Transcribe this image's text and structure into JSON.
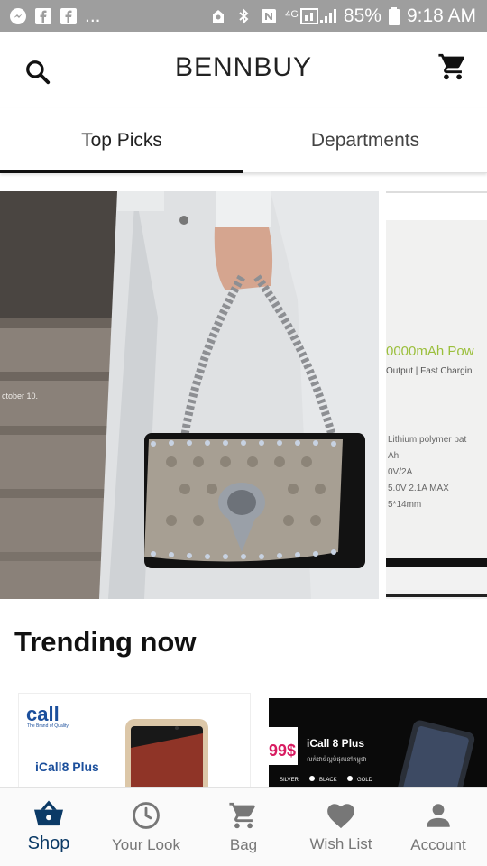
{
  "status_bar": {
    "left_icons": [
      "messenger-icon",
      "facebook-icon",
      "facebook-icon",
      "more-dots"
    ],
    "dots": "...",
    "right_icons": [
      "alarm-icon",
      "bluetooth-icon",
      "nfc-icon",
      "4g-icon",
      "signal-icon"
    ],
    "network": "4G",
    "battery": "85%",
    "time": "9:18 AM"
  },
  "app_bar": {
    "title": "BENNBUY",
    "search_icon": "search-icon",
    "cart_icon": "cart-icon"
  },
  "tabs": [
    {
      "label": "Top Picks",
      "active": true
    },
    {
      "label": "Departments",
      "active": false
    }
  ],
  "carousel": {
    "slide2": {
      "headline": "0000mAh Pow",
      "subline": "Output | Fast Chargin",
      "specs": [
        "Lithium polymer bat",
        "Ah",
        "0V/2A",
        "5.0V 2.1A MAX",
        "5*14mm"
      ]
    },
    "slide1": {
      "caption": "ctober 10."
    }
  },
  "trending": {
    "title": "Trending now"
  },
  "products": [
    {
      "brand": "call",
      "tagline": "The Brand of Quality",
      "name": "iCall8 Plus"
    },
    {
      "price": "99$",
      "name": "iCall 8 Plus",
      "khmer": "លក់ដាច់ល្អបំផុតនៅកម្ពុជា",
      "colors": [
        "SILVER",
        "BLACK",
        "GOLD"
      ]
    }
  ],
  "bottom_nav": [
    {
      "label": "Shop",
      "icon": "basket-icon",
      "active": true
    },
    {
      "label": "Your Look",
      "icon": "clock-icon",
      "active": false
    },
    {
      "label": "Bag",
      "icon": "cart-icon",
      "active": false
    },
    {
      "label": "Wish List",
      "icon": "heart-icon",
      "active": false
    },
    {
      "label": "Account",
      "icon": "person-icon",
      "active": false
    }
  ],
  "colors": {
    "status_bar": "#9e9e9e",
    "accent": "#0b3a66",
    "text": "#222222"
  }
}
